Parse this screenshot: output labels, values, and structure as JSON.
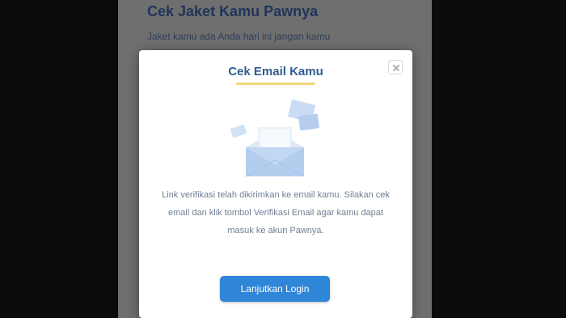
{
  "background": {
    "title": "Cek Jaket Kamu Pawnya",
    "subtitle": "Jaket kamu ada Anda hari ini jangan kamu"
  },
  "modal": {
    "title": "Cek Email Kamu",
    "message": "Link verifikasi telah dikirimkan ke email kamu. Silakan cek email dan klik tombol Verifikasi Email agar kamu dapat masuk ke akun Pawnya.",
    "button_label": "Lanjutkan Login",
    "icons": {
      "close": "close-icon",
      "illustration": "email-envelope-illustration"
    }
  },
  "colors": {
    "accent": "#2f86d9",
    "title": "#2f5b8f",
    "underline": "#f2d77a"
  }
}
